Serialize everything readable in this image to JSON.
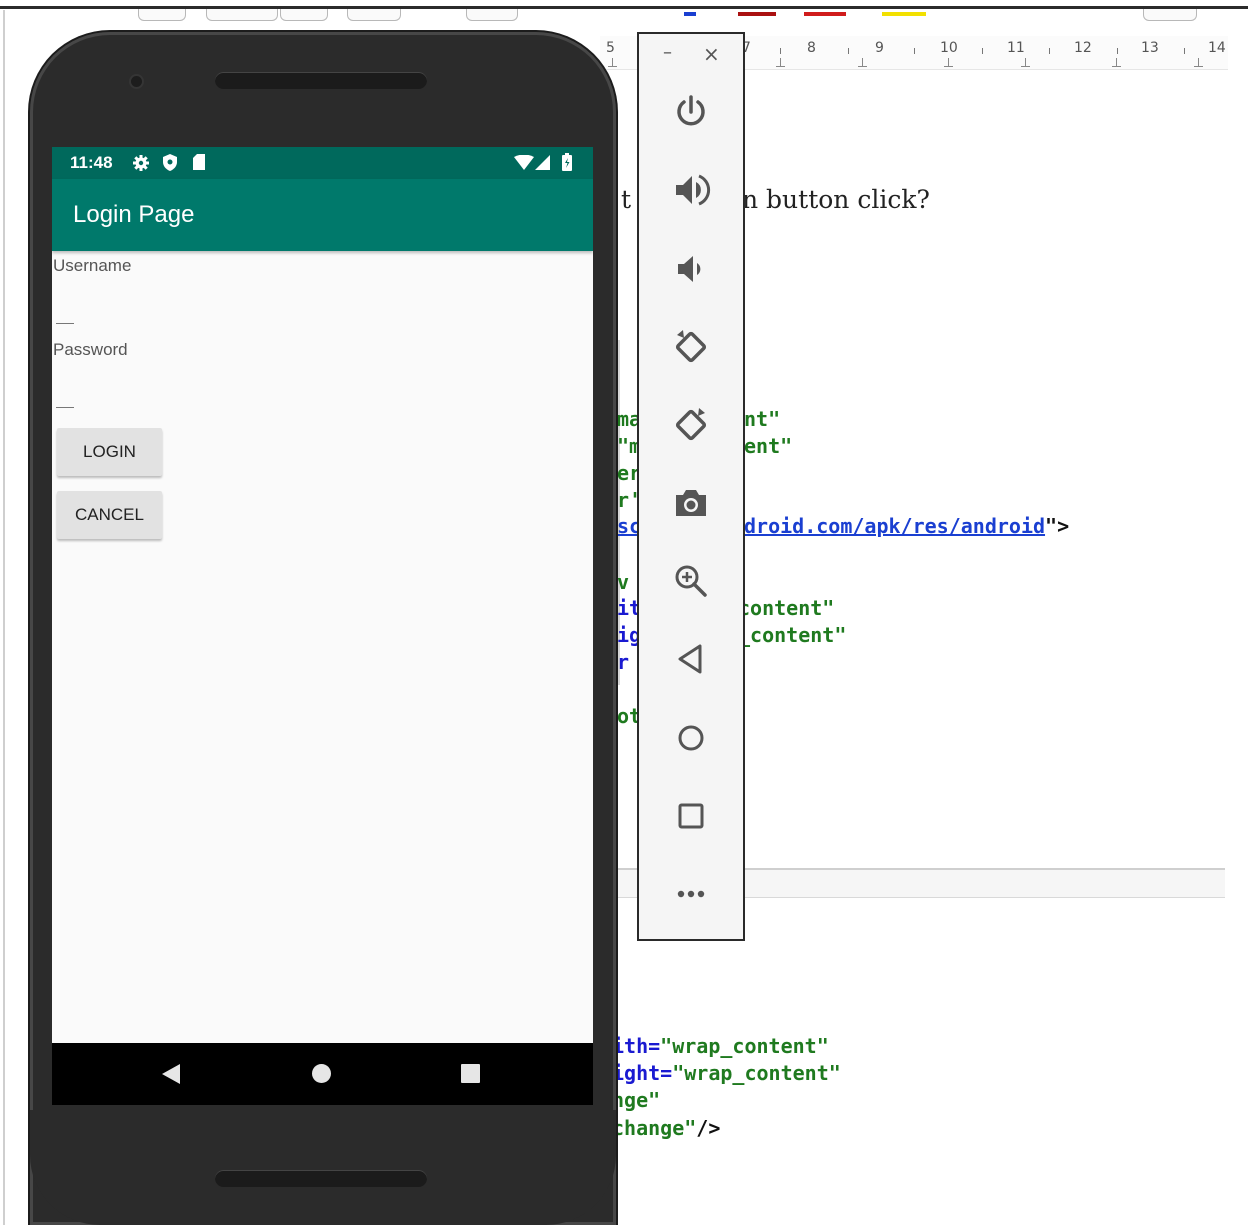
{
  "document": {
    "ruler_numbers": [
      "5",
      "7",
      "8",
      "9",
      "10",
      "11",
      "12",
      "13",
      "14"
    ],
    "text_fragments": {
      "question_left": "t",
      "question_right": "n button click?"
    },
    "code_lines_top": [
      {
        "left": "ma",
        "right": "nt\""
      },
      {
        "left": "\"m",
        "right": "ent\""
      },
      {
        "left": "er",
        "right": ""
      },
      {
        "left": "r'",
        "right": ""
      },
      {
        "left": "sc",
        "right_link": "droid.com/apk/res/android",
        "right_tail": "\">"
      },
      {
        "left": "v",
        "right": ""
      },
      {
        "left": "it",
        "right": "content\""
      },
      {
        "left": "ig",
        "right": "_content\""
      },
      {
        "left": "r",
        "right": ""
      },
      {
        "left": "ot",
        "right": ""
      }
    ],
    "code_lines_bottom": [
      {
        "attr": "ith=",
        "value": "\"wrap_content\""
      },
      {
        "attr": "ight=",
        "value": "\"wrap_content\""
      },
      {
        "attr": "",
        "value": "nge\""
      },
      {
        "attr": "",
        "value": "change\"",
        "tail": "/>"
      }
    ]
  },
  "phone": {
    "status_time": "11:48",
    "app_title": "Login Page",
    "username_label": "Username",
    "password_label": "Password",
    "username_value": "",
    "password_value": "",
    "login_label": "LOGIN",
    "cancel_label": "CANCEL",
    "colors": {
      "status_bar": "#00695c",
      "app_bar": "#00796b",
      "screen_bg": "#fafafa",
      "button_bg": "#e2e2e2"
    }
  },
  "emulator_toolbar": {
    "minimize_label": "–",
    "close_label": "×",
    "icons": [
      "power-icon",
      "volume-up-icon",
      "volume-down-icon",
      "rotate-left-icon",
      "rotate-right-icon",
      "camera-icon",
      "zoom-icon",
      "back-icon",
      "home-icon",
      "overview-icon",
      "more-icon"
    ]
  }
}
